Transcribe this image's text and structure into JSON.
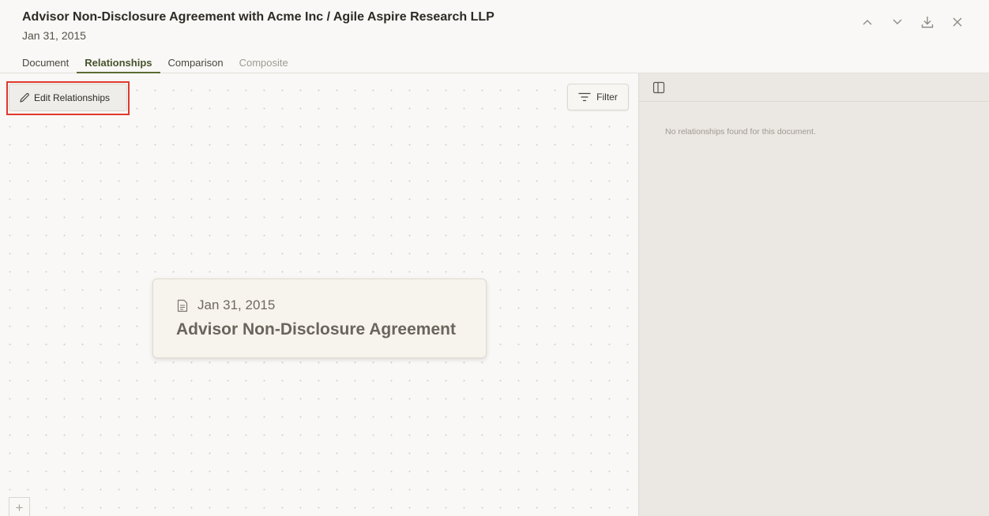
{
  "header": {
    "title": "Advisor Non-Disclosure Agreement with Acme Inc / Agile Aspire Research LLP",
    "date": "Jan 31, 2015",
    "actions": [
      "chevron-up-icon",
      "chevron-down-icon",
      "download-icon",
      "close-icon"
    ]
  },
  "tabs": [
    {
      "label": "Document"
    },
    {
      "label": "Relationships"
    },
    {
      "label": "Comparison"
    },
    {
      "label": "Composite"
    }
  ],
  "active_tab": "Relationships",
  "canvas": {
    "edit_button_label": "Edit Relationships",
    "filter_button_label": "Filter",
    "zoom_in_label": "+",
    "node": {
      "date": "Jan 31, 2015",
      "title": "Advisor Non-Disclosure Agreement"
    }
  },
  "panel": {
    "empty_message": "No relationships found for this document."
  },
  "colors": {
    "accent": "#5b6b33",
    "highlight_outline": "#e0392b"
  }
}
